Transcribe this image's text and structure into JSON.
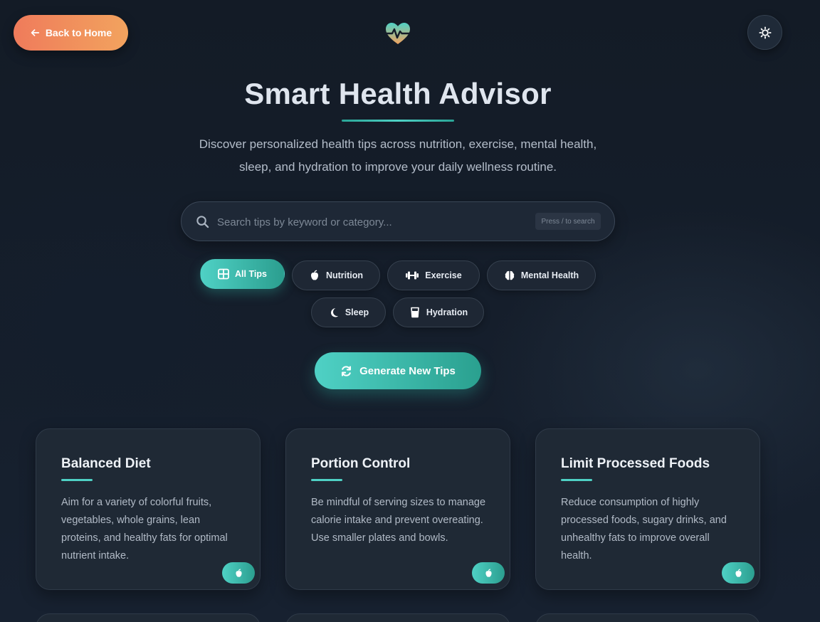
{
  "header": {
    "back_label": "Back to Home",
    "logo_icon": "heart-pulse-icon",
    "theme_icon": "sun-icon",
    "title": "Smart Health Advisor",
    "subtitle": "Discover personalized health tips across nutrition, exercise, mental health, sleep, and hydration to improve your daily wellness routine."
  },
  "search": {
    "placeholder": "Search tips by keyword or category...",
    "value": "",
    "hint": "Press / to search"
  },
  "filters": [
    {
      "label": "All Tips",
      "icon": "grid-icon",
      "active": true
    },
    {
      "label": "Nutrition",
      "icon": "apple-icon",
      "active": false
    },
    {
      "label": "Exercise",
      "icon": "dumbbell-icon",
      "active": false
    },
    {
      "label": "Mental Health",
      "icon": "brain-icon",
      "active": false
    },
    {
      "label": "Sleep",
      "icon": "moon-icon",
      "active": false
    },
    {
      "label": "Hydration",
      "icon": "glass-icon",
      "active": false
    }
  ],
  "generate_label": "Generate New Tips",
  "cards": [
    {
      "title": "Balanced Diet",
      "text": "Aim for a variety of colorful fruits, vegetables, whole grains, lean proteins, and healthy fats for optimal nutrient intake.",
      "icon": "apple-icon"
    },
    {
      "title": "Portion Control",
      "text": "Be mindful of serving sizes to manage calorie intake and prevent overeating. Use smaller plates and bowls.",
      "icon": "apple-icon"
    },
    {
      "title": "Limit Processed Foods",
      "text": "Reduce consumption of highly processed foods, sugary drinks, and unhealthy fats to improve overall health.",
      "icon": "apple-icon"
    }
  ],
  "colors": {
    "accent": "#4fd1c5",
    "accent_dark": "#2b9e8f",
    "back_start": "#ef7b5b",
    "back_end": "#f2a35e",
    "background": "#141c28",
    "card": "#1f2935"
  }
}
